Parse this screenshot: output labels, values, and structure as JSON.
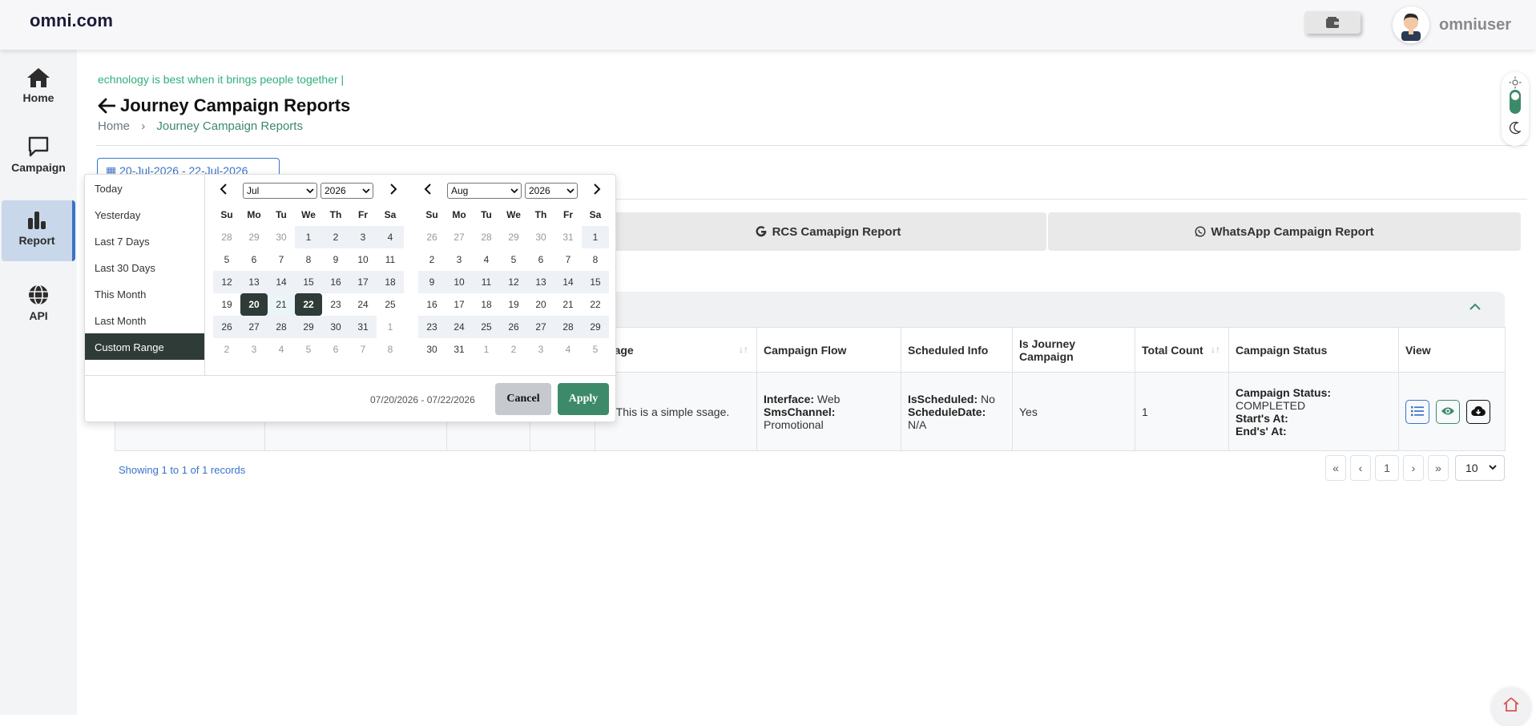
{
  "brand": "omni.com",
  "user": {
    "name": "omniuser"
  },
  "sidebar": {
    "items": [
      {
        "label": "Home",
        "icon": "home-icon"
      },
      {
        "label": "Campaign",
        "icon": "chat-icon"
      },
      {
        "label": "Report",
        "icon": "bar-chart-icon",
        "active": true
      },
      {
        "label": "API",
        "icon": "globe-icon"
      }
    ]
  },
  "ticker": "echnology is best when it brings people together  |",
  "page": {
    "title": "Journey Campaign Reports",
    "breadcrumb": {
      "home": "Home",
      "sep": "›",
      "current": "Journey Campaign Reports"
    }
  },
  "date_input": "20-Jul-2026 - 22-Jul-2026",
  "report_tabs": [
    {
      "label": "RCS Camapign Report",
      "icon": "google-icon"
    },
    {
      "label": "WhatsApp Campaign Report",
      "icon": "whatsapp-icon"
    }
  ],
  "table": {
    "headers": {
      "message": "ssage",
      "campaign_flow": "Campaign Flow",
      "scheduled_info": "Scheduled Info",
      "is_journey": "Is Journey Campaign",
      "total_count": "Total Count",
      "campaign_status": "Campaign Status",
      "view": "View"
    },
    "row": {
      "message": "llo This is a simple ssage.",
      "flow_interface_label": "Interface:",
      "flow_interface_value": "Web",
      "flow_channel_label": "SmsChannel:",
      "flow_channel_value": "Promotional",
      "sched_label": "IsScheduled:",
      "sched_value": "No",
      "sched_date_label": "ScheduleDate:",
      "sched_date_value": "N/A",
      "is_journey": "Yes",
      "total_count": "1",
      "status_label": "Campaign Status:",
      "status_value": "COMPLETED",
      "start_label": "Start's At:",
      "end_label": "End's' At:"
    }
  },
  "records": "Showing 1 to 1 of 1 records",
  "pager": {
    "first": "«",
    "prev": "‹",
    "page": "1",
    "next": "›",
    "last": "»"
  },
  "per_page": "10",
  "picker": {
    "ranges": [
      "Today",
      "Yesterday",
      "Last 7 Days",
      "Last 30 Days",
      "This Month",
      "Last Month",
      "Custom Range"
    ],
    "active_range": "Custom Range",
    "left": {
      "month": "Jul",
      "year": "2026"
    },
    "right": {
      "month": "Aug",
      "year": "2026"
    },
    "dow": [
      "Su",
      "Mo",
      "Tu",
      "We",
      "Th",
      "Fr",
      "Sa"
    ],
    "left_days": [
      {
        "d": "28",
        "t": "off"
      },
      {
        "d": "29",
        "t": "off"
      },
      {
        "d": "30",
        "t": "off"
      },
      {
        "d": "1",
        "t": "cur"
      },
      {
        "d": "2",
        "t": "cur"
      },
      {
        "d": "3",
        "t": "cur"
      },
      {
        "d": "4",
        "t": "cur"
      },
      {
        "d": "5",
        "t": "n"
      },
      {
        "d": "6",
        "t": "n"
      },
      {
        "d": "7",
        "t": "n"
      },
      {
        "d": "8",
        "t": "n"
      },
      {
        "d": "9",
        "t": "n"
      },
      {
        "d": "10",
        "t": "n"
      },
      {
        "d": "11",
        "t": "n"
      },
      {
        "d": "12",
        "t": "cur"
      },
      {
        "d": "13",
        "t": "cur"
      },
      {
        "d": "14",
        "t": "cur"
      },
      {
        "d": "15",
        "t": "cur"
      },
      {
        "d": "16",
        "t": "cur"
      },
      {
        "d": "17",
        "t": "cur"
      },
      {
        "d": "18",
        "t": "cur"
      },
      {
        "d": "19",
        "t": "n"
      },
      {
        "d": "20",
        "t": "sel-end"
      },
      {
        "d": "21",
        "t": "inrange"
      },
      {
        "d": "22",
        "t": "sel-end"
      },
      {
        "d": "23",
        "t": "n"
      },
      {
        "d": "24",
        "t": "n"
      },
      {
        "d": "25",
        "t": "n"
      },
      {
        "d": "26",
        "t": "cur"
      },
      {
        "d": "27",
        "t": "cur"
      },
      {
        "d": "28",
        "t": "cur"
      },
      {
        "d": "29",
        "t": "cur"
      },
      {
        "d": "30",
        "t": "cur"
      },
      {
        "d": "31",
        "t": "cur"
      },
      {
        "d": "1",
        "t": "off"
      },
      {
        "d": "2",
        "t": "off"
      },
      {
        "d": "3",
        "t": "off"
      },
      {
        "d": "4",
        "t": "off"
      },
      {
        "d": "5",
        "t": "off"
      },
      {
        "d": "6",
        "t": "off"
      },
      {
        "d": "7",
        "t": "off"
      },
      {
        "d": "8",
        "t": "off"
      }
    ],
    "right_days": [
      {
        "d": "26",
        "t": "off"
      },
      {
        "d": "27",
        "t": "off"
      },
      {
        "d": "28",
        "t": "off"
      },
      {
        "d": "29",
        "t": "off"
      },
      {
        "d": "30",
        "t": "off"
      },
      {
        "d": "31",
        "t": "off"
      },
      {
        "d": "1",
        "t": "cur"
      },
      {
        "d": "2",
        "t": "n"
      },
      {
        "d": "3",
        "t": "n"
      },
      {
        "d": "4",
        "t": "n"
      },
      {
        "d": "5",
        "t": "n"
      },
      {
        "d": "6",
        "t": "n"
      },
      {
        "d": "7",
        "t": "n"
      },
      {
        "d": "8",
        "t": "n"
      },
      {
        "d": "9",
        "t": "cur"
      },
      {
        "d": "10",
        "t": "cur"
      },
      {
        "d": "11",
        "t": "cur"
      },
      {
        "d": "12",
        "t": "cur"
      },
      {
        "d": "13",
        "t": "cur"
      },
      {
        "d": "14",
        "t": "cur"
      },
      {
        "d": "15",
        "t": "cur"
      },
      {
        "d": "16",
        "t": "n"
      },
      {
        "d": "17",
        "t": "n"
      },
      {
        "d": "18",
        "t": "n"
      },
      {
        "d": "19",
        "t": "n"
      },
      {
        "d": "20",
        "t": "n"
      },
      {
        "d": "21",
        "t": "n"
      },
      {
        "d": "22",
        "t": "n"
      },
      {
        "d": "23",
        "t": "cur"
      },
      {
        "d": "24",
        "t": "cur"
      },
      {
        "d": "25",
        "t": "cur"
      },
      {
        "d": "26",
        "t": "cur"
      },
      {
        "d": "27",
        "t": "cur"
      },
      {
        "d": "28",
        "t": "cur"
      },
      {
        "d": "29",
        "t": "cur"
      },
      {
        "d": "30",
        "t": "n"
      },
      {
        "d": "31",
        "t": "n"
      },
      {
        "d": "1",
        "t": "off"
      },
      {
        "d": "2",
        "t": "off"
      },
      {
        "d": "3",
        "t": "off"
      },
      {
        "d": "4",
        "t": "off"
      },
      {
        "d": "5",
        "t": "off"
      }
    ],
    "footer_range": "07/20/2026 - 07/22/2026",
    "cancel": "Cancel",
    "apply": "Apply"
  },
  "colors": {
    "accent_green": "#3d8a6a",
    "accent_blue": "#3a73c9",
    "selected_dark": "#2e3b36"
  }
}
